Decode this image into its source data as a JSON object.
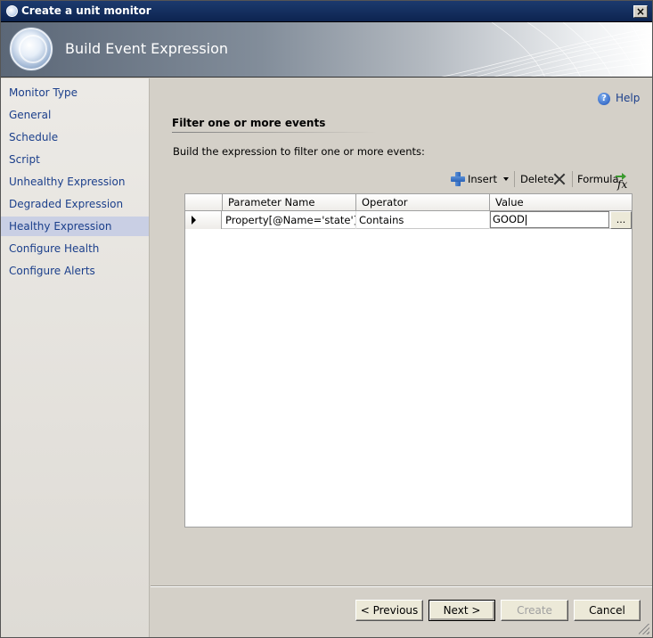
{
  "window": {
    "title": "Create a unit monitor",
    "close_label": "×"
  },
  "banner": {
    "title": "Build Event Expression"
  },
  "nav": {
    "items": [
      {
        "label": "Monitor Type"
      },
      {
        "label": "General"
      },
      {
        "label": "Schedule"
      },
      {
        "label": "Script"
      },
      {
        "label": "Unhealthy Expression"
      },
      {
        "label": "Degraded Expression"
      },
      {
        "label": "Healthy Expression",
        "active": true
      },
      {
        "label": "Configure Health"
      },
      {
        "label": "Configure Alerts"
      }
    ]
  },
  "help": {
    "label": "Help",
    "icon": "?"
  },
  "main": {
    "section_title": "Filter one or more events",
    "instructions": "Build the expression to filter one or more events:"
  },
  "toolbar": {
    "insert_label": "Insert",
    "delete_label": "Delete",
    "formula_label": "Formula",
    "fx_glyph": "fx"
  },
  "grid": {
    "columns": [
      "Parameter Name",
      "Operator",
      "Value"
    ],
    "rows": [
      {
        "parameter": "Property[@Name='state']",
        "operator": "Contains",
        "value": "GOOD"
      }
    ],
    "ellipsis_label": "..."
  },
  "buttons": {
    "previous": "< Previous",
    "next": "Next >",
    "create": "Create",
    "cancel": "Cancel"
  },
  "colors": {
    "link_blue": "#1b3f8b",
    "active_nav": "#c9cfe4",
    "titlebar": "#0d2450"
  }
}
